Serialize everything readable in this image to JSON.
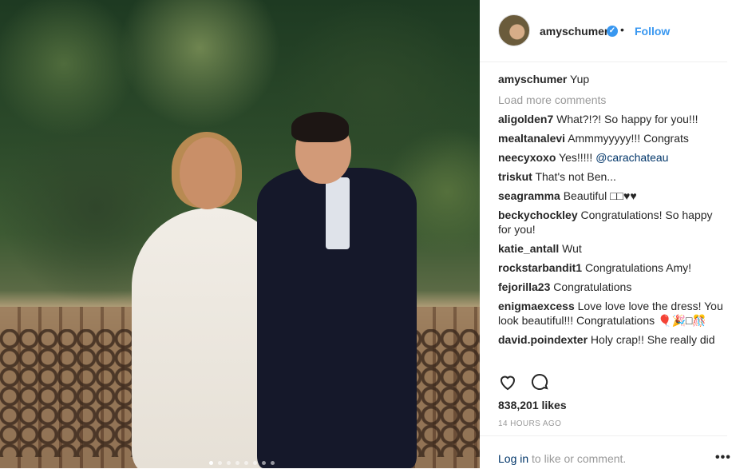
{
  "post": {
    "username": "amyschumer",
    "separator": "•",
    "follow_label": "Follow",
    "caption_user": "amyschumer",
    "caption_text": "Yup",
    "load_more": "Load more comments",
    "comments": [
      {
        "user": "aligolden7",
        "text": "What?!?! So happy for you!!!"
      },
      {
        "user": "mealtanalevi",
        "text": "Ammmyyyyy!!! Congrats"
      },
      {
        "user": "neecyxoxo",
        "text": "Yes!!!!! ",
        "mention": "@carachateau"
      },
      {
        "user": "triskut",
        "text": "That's not Ben..."
      },
      {
        "user": "seagramma",
        "text": "Beautiful □□♥♥"
      },
      {
        "user": "beckychockley",
        "text": "Congratulations! So happy for you!"
      },
      {
        "user": "katie_antall",
        "text": "Wut"
      },
      {
        "user": "rockstarbandit1",
        "text": "Congratulations Amy!"
      },
      {
        "user": "fejorilla23",
        "text": "Congratulations"
      },
      {
        "user": "enigmaexcess",
        "text": "Love love love the dress! You look beautiful!!! Congratulations 🎈🎉□🎊"
      },
      {
        "user": "david.poindexter",
        "text": "Holy crap!! She really did"
      }
    ],
    "likes": "838,201 likes",
    "time": "14 HOURS AGO",
    "login_link": "Log in",
    "login_rest": " to like or comment.",
    "more": "•••"
  },
  "icons": {
    "like": "heart-icon",
    "comment": "comment-icon",
    "more": "more-options-icon",
    "verified": "verified-badge-icon"
  },
  "colors": {
    "accent": "#3897f0",
    "text": "#262626",
    "muted": "#999999",
    "link": "#003569"
  },
  "carousel": {
    "count": 8,
    "active_index": 0
  }
}
